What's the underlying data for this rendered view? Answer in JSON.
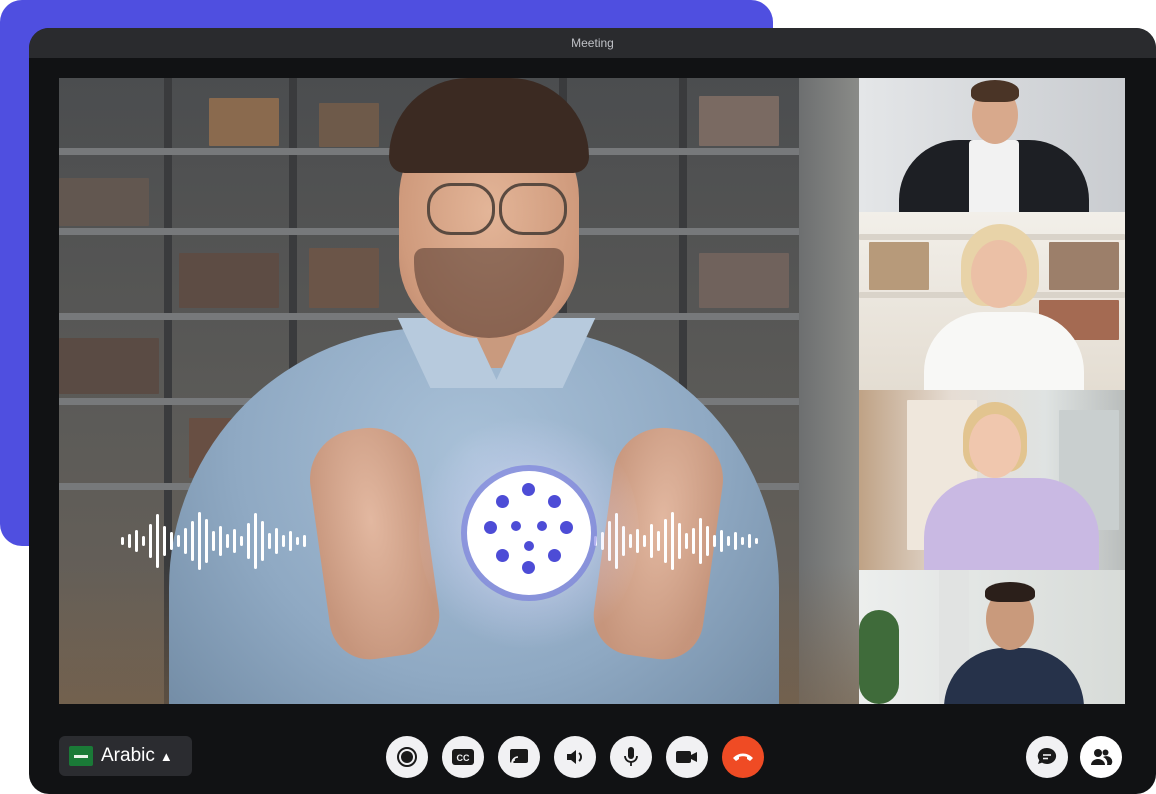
{
  "window": {
    "title": "Meeting"
  },
  "language": {
    "label": "Arabic"
  },
  "controls": [
    {
      "name": "record-button",
      "icon": "record-icon"
    },
    {
      "name": "captions-button",
      "icon": "cc-icon",
      "label": "CC"
    },
    {
      "name": "cast-button",
      "icon": "cast-icon"
    },
    {
      "name": "speaker-button",
      "icon": "speaker-icon"
    },
    {
      "name": "microphone-button",
      "icon": "microphone-icon"
    },
    {
      "name": "camera-button",
      "icon": "video-camera-icon"
    },
    {
      "name": "end-call-button",
      "icon": "phone-hangup-icon",
      "color": "#ef4b24"
    }
  ],
  "right_controls": [
    {
      "name": "chat-button",
      "icon": "chat-bubble-icon"
    },
    {
      "name": "participants-button",
      "icon": "people-icon"
    }
  ],
  "colors": {
    "accent": "#4f4fe0",
    "voice_dots": "#4d4cd6",
    "end_call": "#ef4b24"
  }
}
